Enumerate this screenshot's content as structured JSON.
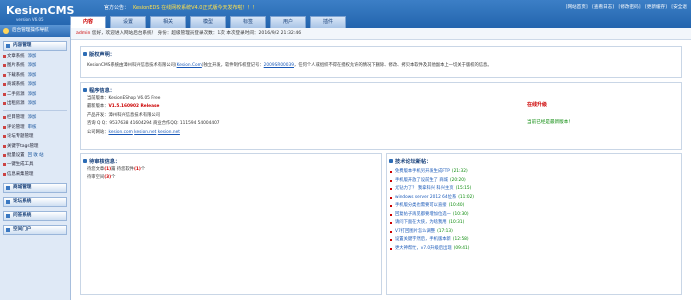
{
  "logo": {
    "title": "KesionCMS",
    "version": "version V6.05"
  },
  "notice": {
    "label": "官方公告：",
    "text": "KesionEDS 在线网校系统V4.0正式版今天发布啦！！！"
  },
  "toplinks": [
    "[网站首页]",
    "[查看日志]",
    "[修改密码]",
    "[更新缓存]",
    "[安全退"
  ],
  "tabs": [
    "内容",
    "设置",
    "相关",
    "模型",
    "标签",
    "用户",
    "插件"
  ],
  "sidebar": {
    "header": "后台管理操作导航",
    "sections": [
      {
        "title": "内容管理",
        "rows": [
          {
            "label": "文章系统",
            "action": "添加"
          },
          {
            "label": "图片系统",
            "action": "添加"
          },
          {
            "label": "下载系统",
            "action": "添加"
          },
          {
            "label": "商城系统",
            "action": "添加"
          },
          {
            "label": "二手房源",
            "action": "添加"
          },
          {
            "label": "出租房源",
            "action": "添加"
          }
        ]
      },
      {
        "title": "",
        "rows": [
          {
            "label": "栏目管理",
            "action": "添加"
          },
          {
            "label": "评论管理",
            "action": "审核"
          },
          {
            "label": "论坛专题管理",
            "action": ""
          },
          {
            "label": "关键字tags管理",
            "action": ""
          },
          {
            "label": "批量设置",
            "action": "回 收 站"
          },
          {
            "label": "一键生成工具",
            "action": ""
          },
          {
            "label": "信息采集管理",
            "action": ""
          }
        ]
      }
    ],
    "bottom_sections": [
      "商城管理",
      "论坛系统",
      "问答系统",
      "空间门户"
    ]
  },
  "statusbar": {
    "user": "admin",
    "text": "您好，欢迎进入网站后台系统！ 身份：超级管理员登录次数：1次 本次登录时间：2016/9/2 21:32:46"
  },
  "copyright": {
    "title": "版权声明：",
    "text": "KesionCMS系统由漳州科兴信息技术有限公司(",
    "link": "Kesion.Com",
    "text2": ")独立开发，软件制作权登记号：",
    "reg": "2009SR00039",
    "text3": "，任何个人或组织不得在授权允许的情况下删除、修改、拷贝本软件及其他副本上一切关于版权的信息。"
  },
  "program": {
    "title": "程序信息：",
    "current_label": "当前版本：",
    "current": "KesionEShop V6.05 Free",
    "latest_label": "最新版本：",
    "latest": "V1.5.160902 Release",
    "product_label": "产品开发：",
    "product": "漳州科兴信息技术有限公司",
    "consult_label": "咨询 Q Q：",
    "consult": "9537638 41604294  商业合作QQ: 111594 54004407",
    "site_label": "公司网站：",
    "sites": [
      "kesion.com",
      "kesion.net",
      "kesion.net"
    ],
    "online_upgrade": "在线升级",
    "current_is_latest": "当前已经是最新版本！"
  },
  "pending": {
    "title": "待审核信息：",
    "rows": [
      {
        "label": "待您文章",
        "count": "(1)",
        "label2": "篇  待您软件",
        "count2": "(1)",
        "tail": "个"
      },
      {
        "label": "待审空间",
        "count": "(3)",
        "label2": "个",
        "count2": "",
        "tail": ""
      }
    ]
  },
  "forum_news": {
    "title": "技术论坛新帖：",
    "items": [
      {
        "t": "免费版本手机另开发生成FTP",
        "d": "(21:32)"
      },
      {
        "t": "手机版开放了设前生了 商城",
        "d": "(20:20)"
      },
      {
        "t": "尤钻力了？ 我拿科兴 科兴主页",
        "d": "(15:15)"
      },
      {
        "t": "windows server 2012 64位系",
        "d": "(11:02)"
      },
      {
        "t": "手机版分类也需要可以直接",
        "d": "(10:40)"
      },
      {
        "t": "回复帖子再见都要增加位选一",
        "d": "(10:30)"
      },
      {
        "t": "请问下面在大侠，为啥我用",
        "d": "(10:31)"
      },
      {
        "t": "V7打回图片怎么调整",
        "d": "(17:13)"
      },
      {
        "t": "设置关键字然后，手机版本新",
        "d": "(12:58)"
      },
      {
        "t": "更大神帮忙，v7.0升级后出现",
        "d": "(09:41)"
      }
    ]
  }
}
